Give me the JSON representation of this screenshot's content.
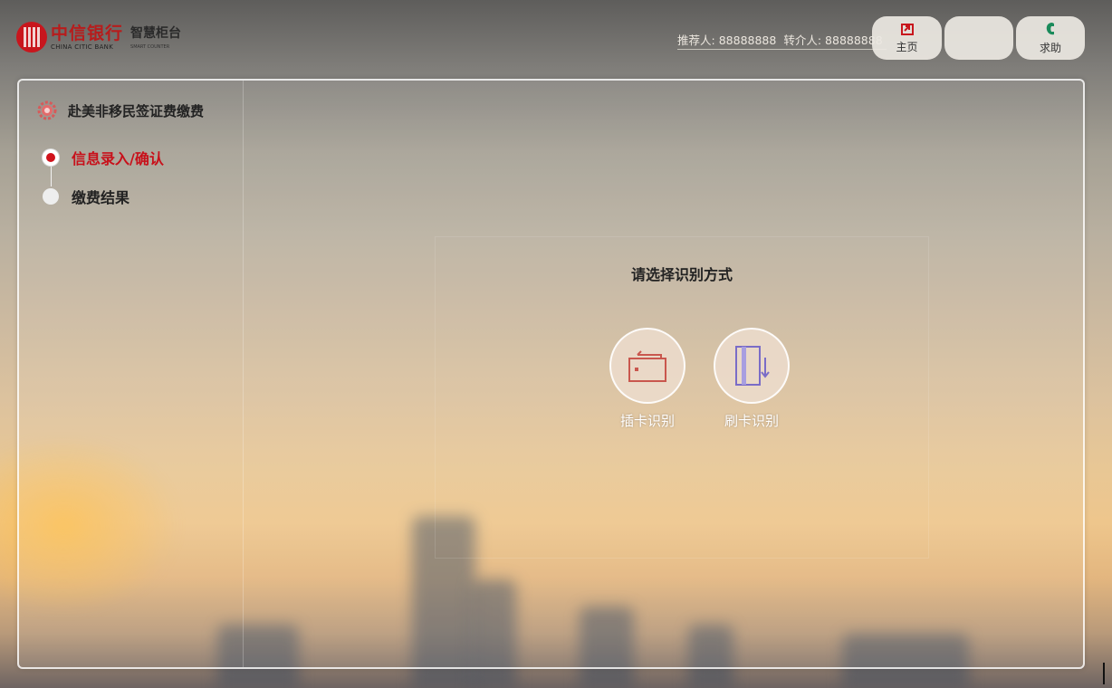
{
  "header": {
    "logo": {
      "cn": "中信银行",
      "en": "CHINA CITIC BANK",
      "sub_cn": "智慧柜台",
      "sub_en": "SMART COUNTER",
      "color": "#c8161d"
    },
    "referrer": {
      "recommender_label": "推荐人:",
      "recommender_value": "88888888",
      "referrer_label": "转介人:",
      "referrer_value": "88888888"
    },
    "buttons": {
      "home": {
        "label": "主页",
        "icon": "home-icon",
        "color": "#c8161d"
      },
      "blank": {
        "label": ""
      },
      "help": {
        "label": "求助",
        "icon": "phone-icon",
        "color": "#1a8a5a"
      }
    }
  },
  "sidebar": {
    "title": "赴美非移民签证费缴费",
    "title_icon": "gear-icon",
    "steps": [
      {
        "label": "信息录入/确认",
        "active": true
      },
      {
        "label": "缴费结果",
        "active": false
      }
    ],
    "accent": "#c8101a"
  },
  "main": {
    "prompt": "请选择识别方式",
    "options": [
      {
        "label": "插卡识别",
        "icon": "card-insert-icon",
        "color": "#c9574e"
      },
      {
        "label": "刷卡识别",
        "icon": "card-swipe-icon",
        "color": "#7a6cc7"
      }
    ]
  }
}
